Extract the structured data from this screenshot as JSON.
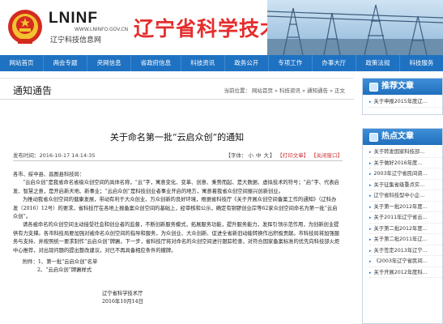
{
  "header": {
    "logo_text": "LNINF",
    "logo_domain": "WWW.LNINFO.GOV.CN",
    "logo_cn": "辽宁科技信息网",
    "site_title": "辽宁省科学技术厅"
  },
  "nav": {
    "items": [
      "网站首页",
      "两会专题",
      "央网信息",
      "省政府信息",
      "科技资讯",
      "政务公开",
      "专项工作",
      "办事大厅",
      "政策法规",
      "科技服务"
    ]
  },
  "section": {
    "title": "通知通告",
    "breadcrumb": [
      "当前位置：",
      "网站首页",
      "»",
      "科技资讯",
      "»",
      "通知通告",
      "»",
      "正文"
    ]
  },
  "article": {
    "title": "关于命名第一批“云启众创”的通知",
    "publish_time": "发布时间：2016-10-17 14:14:35",
    "font_label": "【字体：",
    "font_small": "小",
    "font_medium": "中",
    "font_large": "大",
    "font_end": "】",
    "print_label": "【打印文章】",
    "close_label": "【关闭窗口】",
    "salutation": "各市、绥中县、昌图县科技局：",
    "paragraphs": [
      "“云启众创”是我省命名省级众创空间的具体名称，“云”字，寓意变化、变革、创意、乘势而起、是大数据、虚拟技术的符号；“启”字、代表启发、智慧之意，是开启新天地、新事业；“云启众创”是科技创业者事业开启的地方，寓意着我省众创空间振兴创新创业。",
      "为推动我省众创空间的健康发展，带动有利于大众创业、万众创新的良好环境，根据省科技厅《关于开展众创空间备案工作的通知》（辽科办发〔2016〕12号）的要求，省科技厅在各地上报备案众创空间的基础上，经审核和公示，确定有铜锣创业岸等62家众创空间命名为第一批“云启众创”。",
      "请各被命名的众创空间主动接受社会和创业者的监督，不断创新服务模式，拓展服务功能，提升服务能力，发挥引领示范作用，为创新创业提供有力支撑。各市科技局要加强对被命名众创空间的指导和服务，为众创业、大众创新、促进全省新旧动能转换作出积极贡献。市科技局将加强服务与支持、并按照统一要求制作“云启众创”牌匾，下一步，省科技厅将对命名的众创空间进行跟踪检查，对符合国家备案标准的优先向科技部火炬中心推荐，对出现问题的提出整改建议，对已不再具备相应条件的撤牌。"
    ],
    "attachments_label": "附件：1、第一批“云启众创”名单",
    "attachment_2": "2、“云启众创”牌匾样式",
    "signer": "辽宁省科学技术厅",
    "sign_date": "2016年10月14日"
  },
  "sidebar": {
    "recommend_title": "推荐文章",
    "recommend_items": [
      "关于申报2015年度辽..."
    ],
    "hot_title": "热点文章",
    "hot_items": [
      "关于转发国家科技部...",
      "关于做好2016年度...",
      "2003年辽宁省民间资...",
      "关于征集省级重点实...",
      "辽宁省科技型中小企...",
      "关于第一批2012年度...",
      "关于2011年辽宁省云...",
      "关于第二批2012年度...",
      "关于第二批2011年辽...",
      "关于签定2013年辽宁...",
      "《2003年辽宁省民间...",
      "关于开展2012年度科..."
    ]
  },
  "colors": {
    "nav_blue": "#1f72c2",
    "title_red": "#e52d2d",
    "sidebar_head": "#1f6fbd"
  }
}
